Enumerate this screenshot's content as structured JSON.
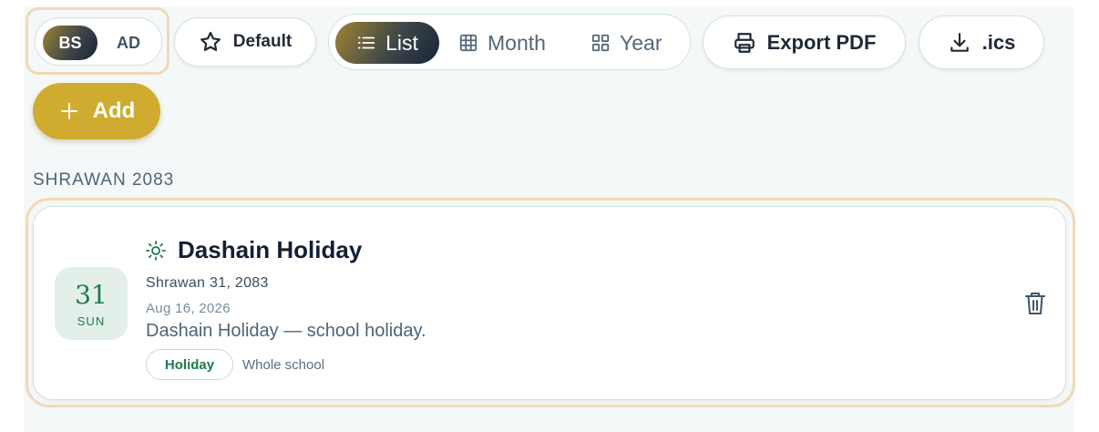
{
  "toolbar": {
    "calendar_toggle": {
      "active": "BS",
      "inactive": "AD"
    },
    "default_label": "Default",
    "views": {
      "list": "List",
      "month": "Month",
      "year": "Year",
      "selected": "List"
    },
    "export_pdf_label": "Export PDF",
    "ics_label": ".ics",
    "add_label": "Add"
  },
  "month_heading": "SHRAWAN 2083",
  "event": {
    "day": "31",
    "weekday": "SUN",
    "title": "Dashain Holiday",
    "date_bs": "Shrawan 31, 2083",
    "date_ad": "Aug 16, 2026",
    "description": "Dashain Holiday — school holiday.",
    "tag": "Holiday",
    "audience": "Whole school"
  },
  "icons": {
    "default": "star-icon",
    "list": "list-icon",
    "month": "grid-icon",
    "year": "squares-icon",
    "pdf": "printer-icon",
    "ics": "download-icon",
    "add": "plus-icon",
    "event": "sun-icon",
    "delete": "trash-icon"
  },
  "colors": {
    "accent_gold": "#cfac30",
    "holiday_green": "#1f7a4f",
    "gradient_start": "#a08332",
    "gradient_end": "#17243b",
    "focus_ring": "#f0d9b6"
  }
}
